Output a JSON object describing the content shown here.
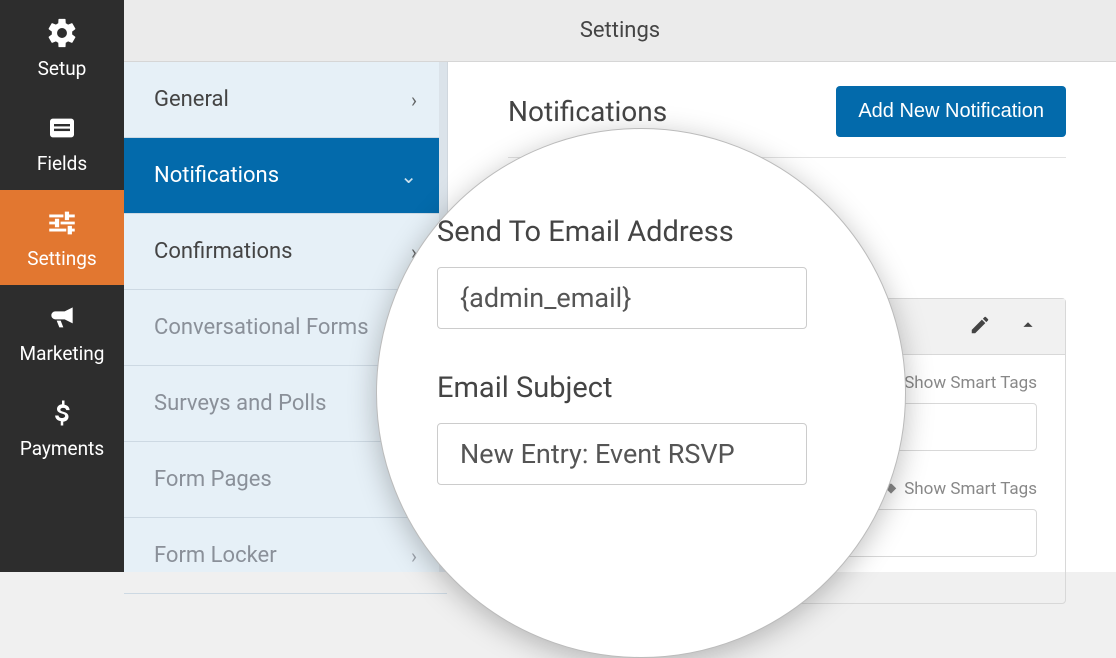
{
  "topbar": {
    "title": "Settings"
  },
  "leftnav": {
    "items": [
      {
        "label": "Setup"
      },
      {
        "label": "Fields"
      },
      {
        "label": "Settings"
      },
      {
        "label": "Marketing"
      },
      {
        "label": "Payments"
      }
    ]
  },
  "subnav": {
    "items": [
      {
        "label": "General"
      },
      {
        "label": "Notifications"
      },
      {
        "label": "Confirmations"
      },
      {
        "label": "Conversational Forms"
      },
      {
        "label": "Surveys and Polls"
      },
      {
        "label": "Form Pages"
      },
      {
        "label": "Form Locker"
      }
    ]
  },
  "main": {
    "heading": "Notifications",
    "add_button": "Add New Notification",
    "smart_tags": "Show Smart Tags"
  },
  "lens": {
    "send_to_label": "Send To Email Address",
    "send_to_value": "{admin_email}",
    "subject_label": "Email Subject",
    "subject_value": "New Entry: Event RSVP"
  }
}
